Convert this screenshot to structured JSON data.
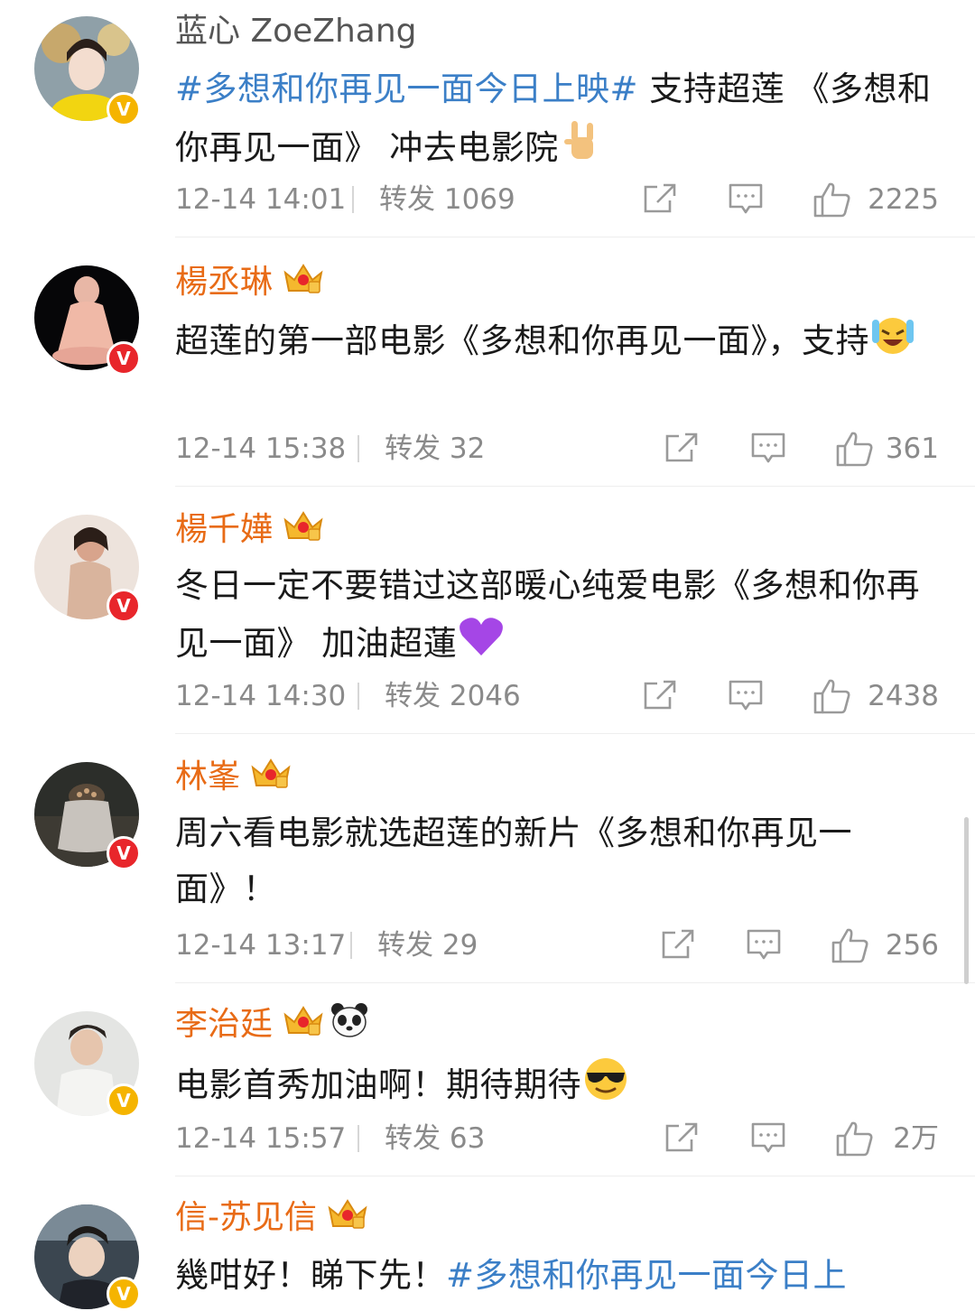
{
  "comments": [
    {
      "name": "蓝心 ZoeZhang",
      "text_hashtag": "#多想和你再见一面今日上映#",
      "text": " 支持超莲 《多想和你再见一面》 冲去电影院",
      "time": "12-14 14:01",
      "repost": "转发 1069",
      "likes": "2225",
      "emoji": "rock-on-hand-emoji",
      "badge": "V",
      "badge_color": "#f5b400"
    },
    {
      "name": "楊丞琳",
      "text": "超莲的第一部电影《多想和你再见一面》，支持",
      "time": "12-14 15:38",
      "repost": "转发 32",
      "likes": "361",
      "emoji": "laughing-tears-emoji",
      "badge": "V",
      "badge_color": "#e8262b"
    },
    {
      "name": "楊千嬅",
      "text": "冬日一定不要错过这部暖心纯爱电影《多想和你再见一面》 加油超蓮",
      "time": "12-14 14:30",
      "repost": "转发 2046",
      "likes": "2438",
      "emoji": "purple-heart-emoji",
      "badge": "V",
      "badge_color": "#e8262b"
    },
    {
      "name": "林峯",
      "text": "周六看电影就选超莲的新片《多想和你再见一面》！",
      "time": "12-14 13:17",
      "repost": "转发 29",
      "likes": "256",
      "badge": "V",
      "badge_color": "#e8262b"
    },
    {
      "name": "李治廷",
      "text": "电影首秀加油啊！期待期待",
      "time": "12-14 15:57",
      "repost": "转发 63",
      "likes": "2万",
      "emoji": "sunglasses-emoji",
      "badge": "V",
      "badge_color": "#f5b400"
    },
    {
      "name": "信-苏见信",
      "text": "幾咁好！睇下先！",
      "text_hashtag": "#多想和你再见一面今日上",
      "badge": "V",
      "badge_color": "#f5b400"
    }
  ],
  "icons": {
    "share": "share-icon",
    "comment": "comment-icon",
    "like": "like-icon",
    "crown": "crown-badge-icon",
    "panda": "panda-icon"
  },
  "colors": {
    "name": "#e86b16",
    "hashtag": "#3b7fc7",
    "meta": "#8a8a8a"
  }
}
